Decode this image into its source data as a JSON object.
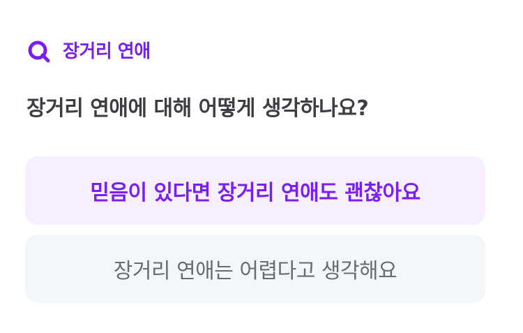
{
  "topic": {
    "icon": "search-q-icon",
    "label": "장거리 연애",
    "accent_color": "#7a1ff0"
  },
  "question": {
    "text": "장거리 연애에 대해 어떻게 생각하나요?"
  },
  "options": [
    {
      "label": "믿음이 있다면 장거리 연애도 괜찮아요",
      "selected": true,
      "background_color": "#f5efff",
      "text_color": "#7a1ff0"
    },
    {
      "label": "장거리 연애는 어렵다고 생각해요",
      "selected": false,
      "background_color": "#f5f6f8",
      "text_color": "#6b6b70"
    }
  ]
}
